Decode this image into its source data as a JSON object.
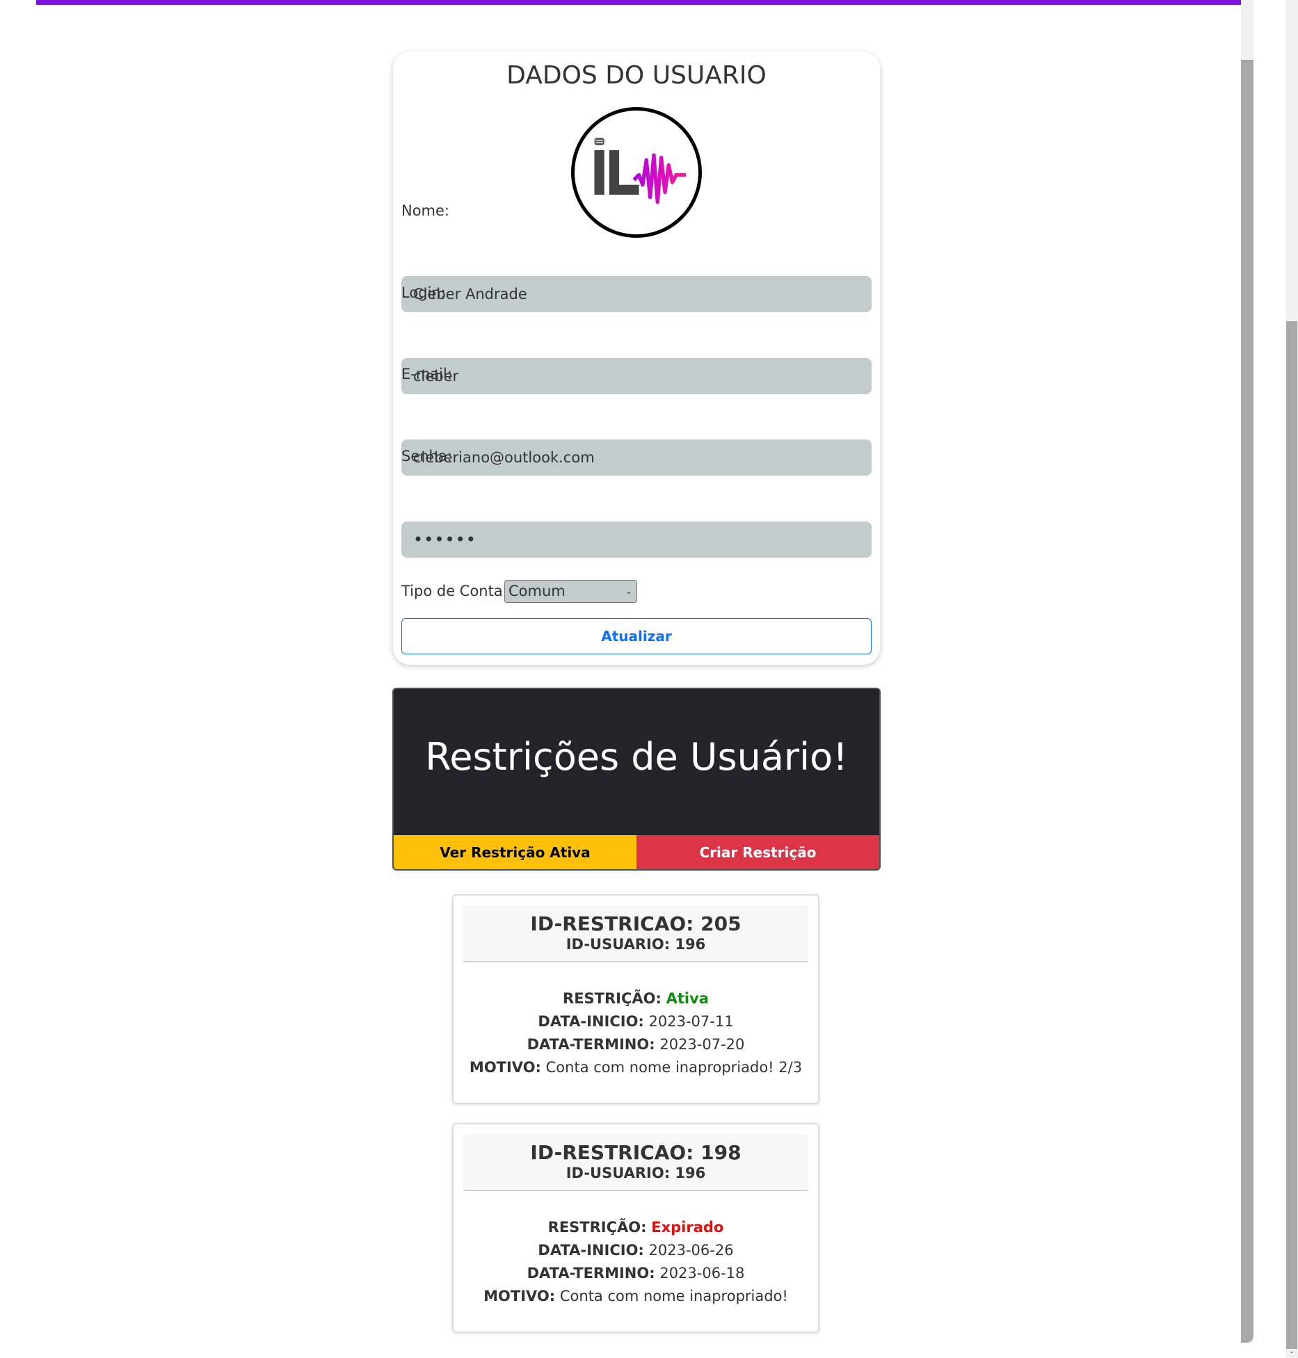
{
  "user_form": {
    "title": "DADOS DO USUARIO",
    "nome_label": "Nome:",
    "nome_value": "Cleber Andrade",
    "login_label": "Login:",
    "login_value": "cleber",
    "email_label": "E-mail:",
    "email_value": "cleberiano@outlook.com",
    "senha_label": "Senha:",
    "senha_value": "••••••",
    "tipo_label": "Tipo de Conta:",
    "tipo_selected": "Comum",
    "update_label": "Atualizar",
    "logo_icon": "il-microphone-soundwave-logo"
  },
  "restrictions_panel": {
    "title": "Restrições de Usuário!",
    "ver_label": "Ver Restrição Ativa",
    "criar_label": "Criar Restrição",
    "colors": {
      "ver": "#ffc107",
      "criar": "#dc3545",
      "panel": "#212529"
    }
  },
  "restrictions": [
    {
      "id_label": "ID-RESTRICAO: 205",
      "user_label": "ID-USUARIO: 196",
      "status_key": "RESTRIÇÃO:",
      "status_value": "Ativa",
      "start_key": "DATA-INICIO:",
      "start_value": "2023-07-11",
      "end_key": "DATA-TERMINO:",
      "end_value": "2023-07-20",
      "reason_key": "MOTIVO:",
      "reason_value": "Conta com nome inapropriado! 2/3"
    },
    {
      "id_label": "ID-RESTRICAO: 198",
      "user_label": "ID-USUARIO: 196",
      "status_key": "RESTRIÇÃO:",
      "status_value": "Expirado",
      "start_key": "DATA-INICIO:",
      "start_value": "2023-06-26",
      "end_key": "DATA-TERMINO:",
      "end_value": "2023-06-18",
      "reason_key": "MOTIVO:",
      "reason_value": "Conta com nome inapropriado!"
    }
  ],
  "colors": {
    "accent_bar": "#7a14dc",
    "input_bg": "#c2cccc",
    "primary": "#0d6efd",
    "active": "#118a11",
    "expired": "#e01010"
  }
}
